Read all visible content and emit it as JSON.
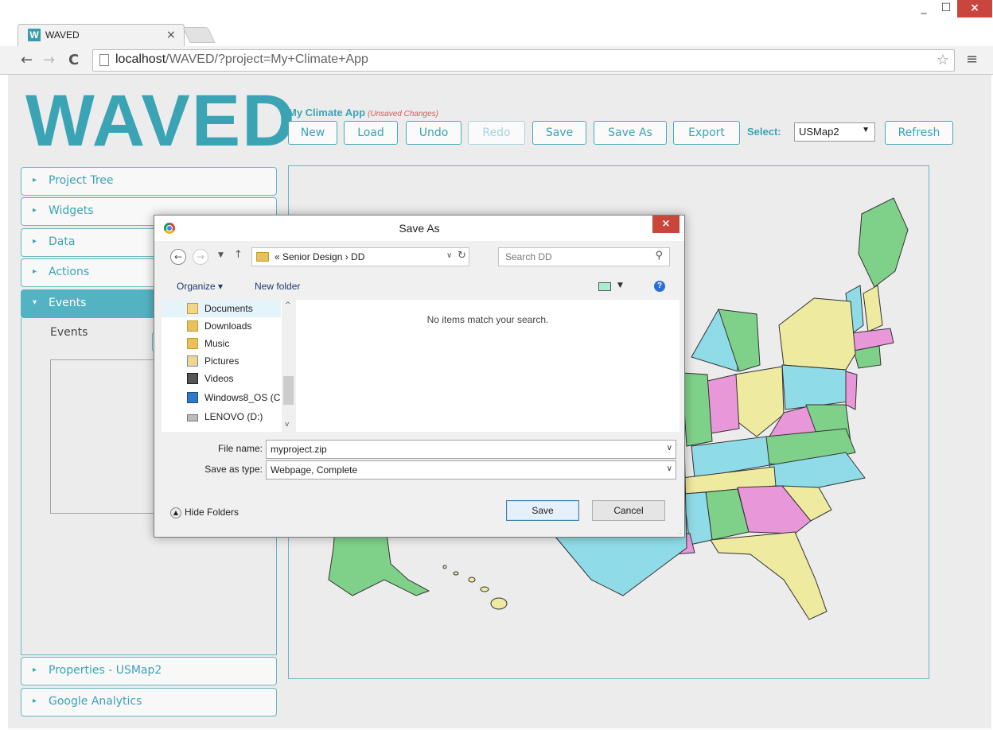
{
  "browser": {
    "tab_title": "WAVED",
    "tab_favicon": "W",
    "url_host": "localhost",
    "url_rest": "/WAVED/?project=My+Climate+App"
  },
  "app": {
    "logo": "WAVED",
    "project_name": "My Climate App",
    "unsaved_note": "(Unsaved Changes)",
    "buttons": {
      "new": "New",
      "load": "Load",
      "undo": "Undo",
      "redo": "Redo",
      "save": "Save",
      "save_as": "Save As",
      "export": "Export",
      "refresh": "Refresh"
    },
    "select_label": "Select:",
    "select_value": "USMap2",
    "accent_color": "#3aa4b5"
  },
  "sidebar": {
    "panels": [
      {
        "label": "Project Tree"
      },
      {
        "label": "Widgets"
      },
      {
        "label": "Data"
      },
      {
        "label": "Actions"
      },
      {
        "label": "Events"
      },
      {
        "label": "Properties - USMap2"
      },
      {
        "label": "Google Analytics"
      }
    ],
    "events_label": "Events"
  },
  "dialog": {
    "title": "Save As",
    "breadcrumb": "« Senior Design › DD",
    "search_placeholder": "Search DD",
    "organize": "Organize ▾",
    "new_folder": "New folder",
    "nav_items": [
      {
        "label": "Documents",
        "icon": "documents-folder-icon"
      },
      {
        "label": "Downloads",
        "icon": "downloads-folder-icon"
      },
      {
        "label": "Music",
        "icon": "music-folder-icon"
      },
      {
        "label": "Pictures",
        "icon": "pictures-folder-icon"
      },
      {
        "label": "Videos",
        "icon": "videos-folder-icon"
      },
      {
        "label": "Windows8_OS (C",
        "icon": "windows-drive-icon"
      },
      {
        "label": "LENOVO (D:)",
        "icon": "drive-icon"
      }
    ],
    "empty_message": "No items match your search.",
    "file_name_label": "File name:",
    "file_name_value": "myproject.zip",
    "save_type_label": "Save as type:",
    "save_type_value": "Webpage, Complete",
    "hide_folders": "Hide Folders",
    "save_button": "Save",
    "cancel_button": "Cancel"
  },
  "map": {
    "state_colors": [
      "#8fdce8",
      "#7fd18a",
      "#eeeaa0",
      "#e898d8"
    ]
  }
}
